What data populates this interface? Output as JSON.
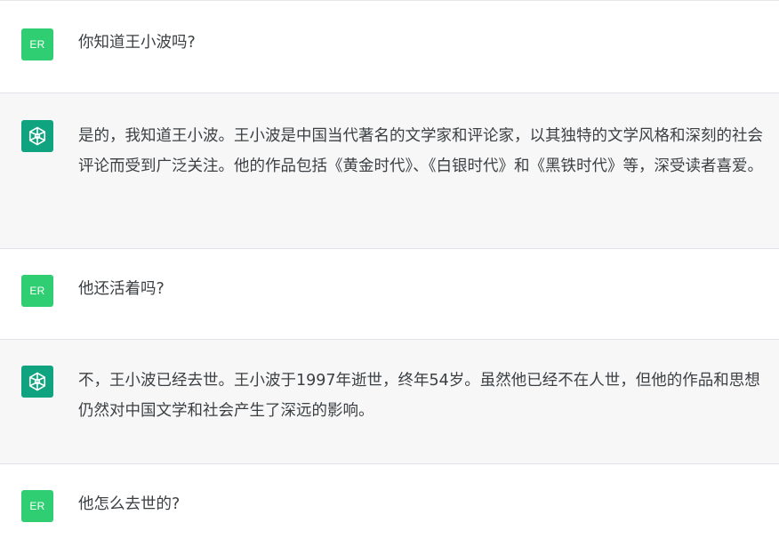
{
  "user_avatar_label": "ER",
  "messages": [
    {
      "role": "user",
      "text": "你知道王小波吗?"
    },
    {
      "role": "assistant",
      "text": "是的，我知道王小波。王小波是中国当代著名的文学家和评论家，以其独特的文学风格和深刻的社会评论而受到广泛关注。他的作品包括《黄金时代》、《白银时代》和《黑铁时代》等，深受读者喜爱。"
    },
    {
      "role": "user",
      "text": "他还活着吗?"
    },
    {
      "role": "assistant",
      "text": "不，王小波已经去世。王小波于1997年逝世，终年54岁。虽然他已经不在人世，但他的作品和思想仍然对中国文学和社会产生了深远的影响。"
    },
    {
      "role": "user",
      "text": "他怎么去世的?"
    }
  ],
  "colors": {
    "user_avatar_bg": "#2fce72",
    "assistant_avatar_bg": "#10a37f",
    "assistant_row_bg": "#f7f7f8",
    "user_row_bg": "#ffffff"
  },
  "icons": {
    "assistant_avatar": "openai-logo-icon"
  }
}
